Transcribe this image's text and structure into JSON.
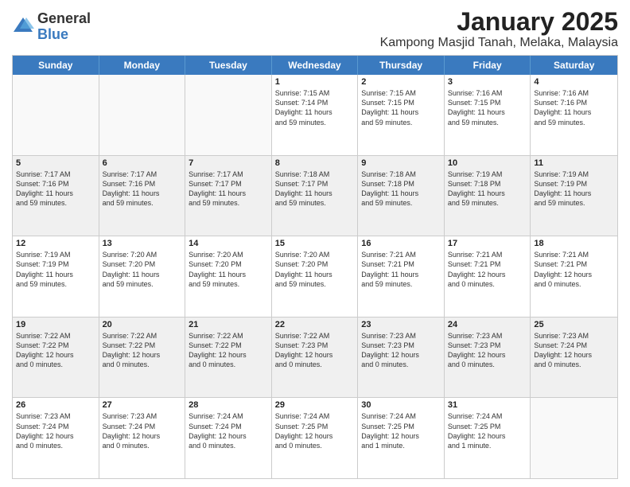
{
  "logo": {
    "general": "General",
    "blue": "Blue"
  },
  "title": "January 2025",
  "subtitle": "Kampong Masjid Tanah, Melaka, Malaysia",
  "header_days": [
    "Sunday",
    "Monday",
    "Tuesday",
    "Wednesday",
    "Thursday",
    "Friday",
    "Saturday"
  ],
  "rows": [
    [
      {
        "num": "",
        "info": "",
        "empty": true
      },
      {
        "num": "",
        "info": "",
        "empty": true
      },
      {
        "num": "",
        "info": "",
        "empty": true
      },
      {
        "num": "1",
        "info": "Sunrise: 7:15 AM\nSunset: 7:14 PM\nDaylight: 11 hours\nand 59 minutes.",
        "empty": false
      },
      {
        "num": "2",
        "info": "Sunrise: 7:15 AM\nSunset: 7:15 PM\nDaylight: 11 hours\nand 59 minutes.",
        "empty": false
      },
      {
        "num": "3",
        "info": "Sunrise: 7:16 AM\nSunset: 7:15 PM\nDaylight: 11 hours\nand 59 minutes.",
        "empty": false
      },
      {
        "num": "4",
        "info": "Sunrise: 7:16 AM\nSunset: 7:16 PM\nDaylight: 11 hours\nand 59 minutes.",
        "empty": false
      }
    ],
    [
      {
        "num": "5",
        "info": "Sunrise: 7:17 AM\nSunset: 7:16 PM\nDaylight: 11 hours\nand 59 minutes.",
        "empty": false
      },
      {
        "num": "6",
        "info": "Sunrise: 7:17 AM\nSunset: 7:16 PM\nDaylight: 11 hours\nand 59 minutes.",
        "empty": false
      },
      {
        "num": "7",
        "info": "Sunrise: 7:17 AM\nSunset: 7:17 PM\nDaylight: 11 hours\nand 59 minutes.",
        "empty": false
      },
      {
        "num": "8",
        "info": "Sunrise: 7:18 AM\nSunset: 7:17 PM\nDaylight: 11 hours\nand 59 minutes.",
        "empty": false
      },
      {
        "num": "9",
        "info": "Sunrise: 7:18 AM\nSunset: 7:18 PM\nDaylight: 11 hours\nand 59 minutes.",
        "empty": false
      },
      {
        "num": "10",
        "info": "Sunrise: 7:19 AM\nSunset: 7:18 PM\nDaylight: 11 hours\nand 59 minutes.",
        "empty": false
      },
      {
        "num": "11",
        "info": "Sunrise: 7:19 AM\nSunset: 7:19 PM\nDaylight: 11 hours\nand 59 minutes.",
        "empty": false
      }
    ],
    [
      {
        "num": "12",
        "info": "Sunrise: 7:19 AM\nSunset: 7:19 PM\nDaylight: 11 hours\nand 59 minutes.",
        "empty": false
      },
      {
        "num": "13",
        "info": "Sunrise: 7:20 AM\nSunset: 7:20 PM\nDaylight: 11 hours\nand 59 minutes.",
        "empty": false
      },
      {
        "num": "14",
        "info": "Sunrise: 7:20 AM\nSunset: 7:20 PM\nDaylight: 11 hours\nand 59 minutes.",
        "empty": false
      },
      {
        "num": "15",
        "info": "Sunrise: 7:20 AM\nSunset: 7:20 PM\nDaylight: 11 hours\nand 59 minutes.",
        "empty": false
      },
      {
        "num": "16",
        "info": "Sunrise: 7:21 AM\nSunset: 7:21 PM\nDaylight: 11 hours\nand 59 minutes.",
        "empty": false
      },
      {
        "num": "17",
        "info": "Sunrise: 7:21 AM\nSunset: 7:21 PM\nDaylight: 12 hours\nand 0 minutes.",
        "empty": false
      },
      {
        "num": "18",
        "info": "Sunrise: 7:21 AM\nSunset: 7:21 PM\nDaylight: 12 hours\nand 0 minutes.",
        "empty": false
      }
    ],
    [
      {
        "num": "19",
        "info": "Sunrise: 7:22 AM\nSunset: 7:22 PM\nDaylight: 12 hours\nand 0 minutes.",
        "empty": false
      },
      {
        "num": "20",
        "info": "Sunrise: 7:22 AM\nSunset: 7:22 PM\nDaylight: 12 hours\nand 0 minutes.",
        "empty": false
      },
      {
        "num": "21",
        "info": "Sunrise: 7:22 AM\nSunset: 7:22 PM\nDaylight: 12 hours\nand 0 minutes.",
        "empty": false
      },
      {
        "num": "22",
        "info": "Sunrise: 7:22 AM\nSunset: 7:23 PM\nDaylight: 12 hours\nand 0 minutes.",
        "empty": false
      },
      {
        "num": "23",
        "info": "Sunrise: 7:23 AM\nSunset: 7:23 PM\nDaylight: 12 hours\nand 0 minutes.",
        "empty": false
      },
      {
        "num": "24",
        "info": "Sunrise: 7:23 AM\nSunset: 7:23 PM\nDaylight: 12 hours\nand 0 minutes.",
        "empty": false
      },
      {
        "num": "25",
        "info": "Sunrise: 7:23 AM\nSunset: 7:24 PM\nDaylight: 12 hours\nand 0 minutes.",
        "empty": false
      }
    ],
    [
      {
        "num": "26",
        "info": "Sunrise: 7:23 AM\nSunset: 7:24 PM\nDaylight: 12 hours\nand 0 minutes.",
        "empty": false
      },
      {
        "num": "27",
        "info": "Sunrise: 7:23 AM\nSunset: 7:24 PM\nDaylight: 12 hours\nand 0 minutes.",
        "empty": false
      },
      {
        "num": "28",
        "info": "Sunrise: 7:24 AM\nSunset: 7:24 PM\nDaylight: 12 hours\nand 0 minutes.",
        "empty": false
      },
      {
        "num": "29",
        "info": "Sunrise: 7:24 AM\nSunset: 7:25 PM\nDaylight: 12 hours\nand 0 minutes.",
        "empty": false
      },
      {
        "num": "30",
        "info": "Sunrise: 7:24 AM\nSunset: 7:25 PM\nDaylight: 12 hours\nand 1 minute.",
        "empty": false
      },
      {
        "num": "31",
        "info": "Sunrise: 7:24 AM\nSunset: 7:25 PM\nDaylight: 12 hours\nand 1 minute.",
        "empty": false
      },
      {
        "num": "",
        "info": "",
        "empty": true
      }
    ]
  ]
}
